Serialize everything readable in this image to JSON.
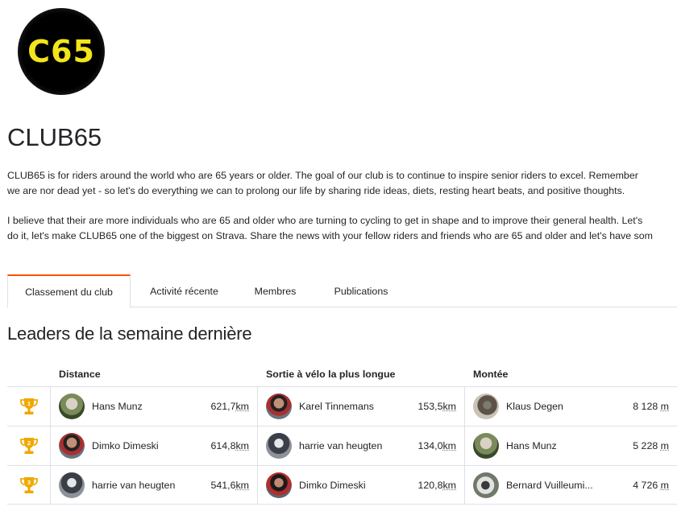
{
  "club": {
    "logo_text": "C65",
    "name": "CLUB65",
    "description": [
      "CLUB65 is for riders around the world who are 65 years or older. The goal of our club is to continue to inspire senior riders to excel. Remember",
      "we are nor dead yet - so let's do everything we can to prolong our life by sharing ride ideas, diets, resting heart beats, and positive thoughts.",
      "I believe that their are more individuals who are 65 and older who are turning to cycling to get in shape and to improve their general health. Let's",
      "do it, let's make CLUB65 one of the biggest on Strava. Share the news with your fellow riders and friends who are 65 and older and let's have som"
    ]
  },
  "tabs": [
    {
      "label": "Classement du club",
      "active": true
    },
    {
      "label": "Activité récente",
      "active": false
    },
    {
      "label": "Membres",
      "active": false
    },
    {
      "label": "Publications",
      "active": false
    }
  ],
  "leaderboard": {
    "title": "Leaders de la semaine dernière",
    "columns": [
      "Distance",
      "Sortie à vélo la plus longue",
      "Montée"
    ],
    "ranks": [
      "1",
      "2",
      "3"
    ],
    "rows": [
      [
        {
          "name": "Hans Munz",
          "value": "621,7",
          "unit": "km"
        },
        {
          "name": "Karel Tinnemans",
          "value": "153,5",
          "unit": "km"
        },
        {
          "name": "Klaus Degen",
          "value": "8 128 ",
          "unit": "m"
        }
      ],
      [
        {
          "name": "Dimko Dimeski",
          "value": "614,8",
          "unit": "km"
        },
        {
          "name": "harrie van heugten",
          "value": "134,0",
          "unit": "km"
        },
        {
          "name": "Hans Munz",
          "value": "5 228 ",
          "unit": "m"
        }
      ],
      [
        {
          "name": "harrie van heugten",
          "value": "541,6",
          "unit": "km"
        },
        {
          "name": "Dimko Dimeski",
          "value": "120,8",
          "unit": "km"
        },
        {
          "name": "Bernard Vuilleumi...",
          "value": "4 726 ",
          "unit": "m"
        }
      ]
    ]
  },
  "colors": {
    "accent": "#fc5200",
    "trophy": "#f0a800",
    "logo_text": "#f2e51a"
  }
}
